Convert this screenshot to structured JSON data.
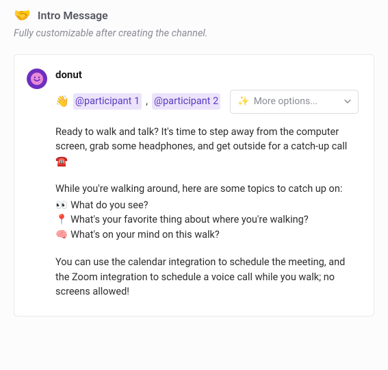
{
  "header": {
    "icon": "🤝",
    "title": "Intro Message"
  },
  "subtitle": "Fully customizable after creating the channel.",
  "message": {
    "bot_name": "donut",
    "wave_emoji": "👋",
    "participants": [
      "@participant 1",
      "@participant 2"
    ],
    "separator": ",",
    "more_options_label": "More options...",
    "sparkle_emoji": "✨",
    "intro_paragraph": "Ready to walk and talk? It's time to step away from the computer screen, grab some headphones, and get outside for a catch-up call ☎️",
    "topics_intro": "While you're walking around, here are some topics to catch up on:",
    "topics": [
      {
        "emoji": "👀",
        "text": "What do you see?"
      },
      {
        "emoji": "📍",
        "text": "What's your favorite thing about where you're walking?"
      },
      {
        "emoji": "🧠",
        "text": "What's on your mind on this walk?"
      }
    ],
    "closing_paragraph": "You can use the calendar integration to schedule the meeting, and the Zoom integration to schedule a voice call while you walk; no screens allowed!"
  }
}
